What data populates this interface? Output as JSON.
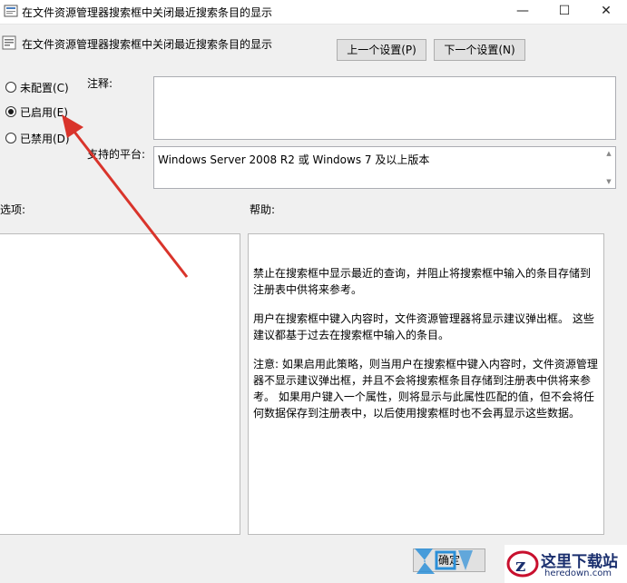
{
  "window": {
    "title": "在文件资源管理器搜索框中关闭最近搜索条目的显示",
    "minimize_glyph": "—",
    "maximize_glyph": "☐",
    "close_glyph": "✕"
  },
  "header": {
    "policy_name": "在文件资源管理器搜索框中关闭最近搜索条目的显示",
    "prev_button": "上一个设置(P)",
    "next_button": "下一个设置(N)"
  },
  "state": {
    "options": [
      {
        "label": "未配置(C)",
        "selected": false
      },
      {
        "label": "已启用(E)",
        "selected": true
      },
      {
        "label": "已禁用(D)",
        "selected": false
      }
    ]
  },
  "comment": {
    "label": "注释:",
    "value": ""
  },
  "platform": {
    "label": "支持的平台:",
    "value": "Windows Server 2008 R2 或 Windows 7 及以上版本"
  },
  "options_section": {
    "label": "选项:"
  },
  "help": {
    "label": "帮助:",
    "paragraphs": [
      "禁止在搜索框中显示最近的查询，并阻止将搜索框中输入的条目存储到注册表中供将来参考。",
      "用户在搜索框中键入内容时，文件资源管理器将显示建议弹出框。 这些建议都基于过去在搜索框中输入的条目。",
      "注意: 如果启用此策略，则当用户在搜索框中键入内容时，文件资源管理器不显示建议弹出框，并且不会将搜索框条目存储到注册表中供将来参考。 如果用户键入一个属性，则将显示与此属性匹配的值，但不会将任何数据保存到注册表中，以后使用搜索框时也不会再显示这些数据。"
    ]
  },
  "footer": {
    "ok_button_partial": "确定",
    "watermark_brand": "这里下载站",
    "watermark_domain": "heredown.com"
  },
  "annotation": {
    "arrow_color": "#d9342b"
  }
}
